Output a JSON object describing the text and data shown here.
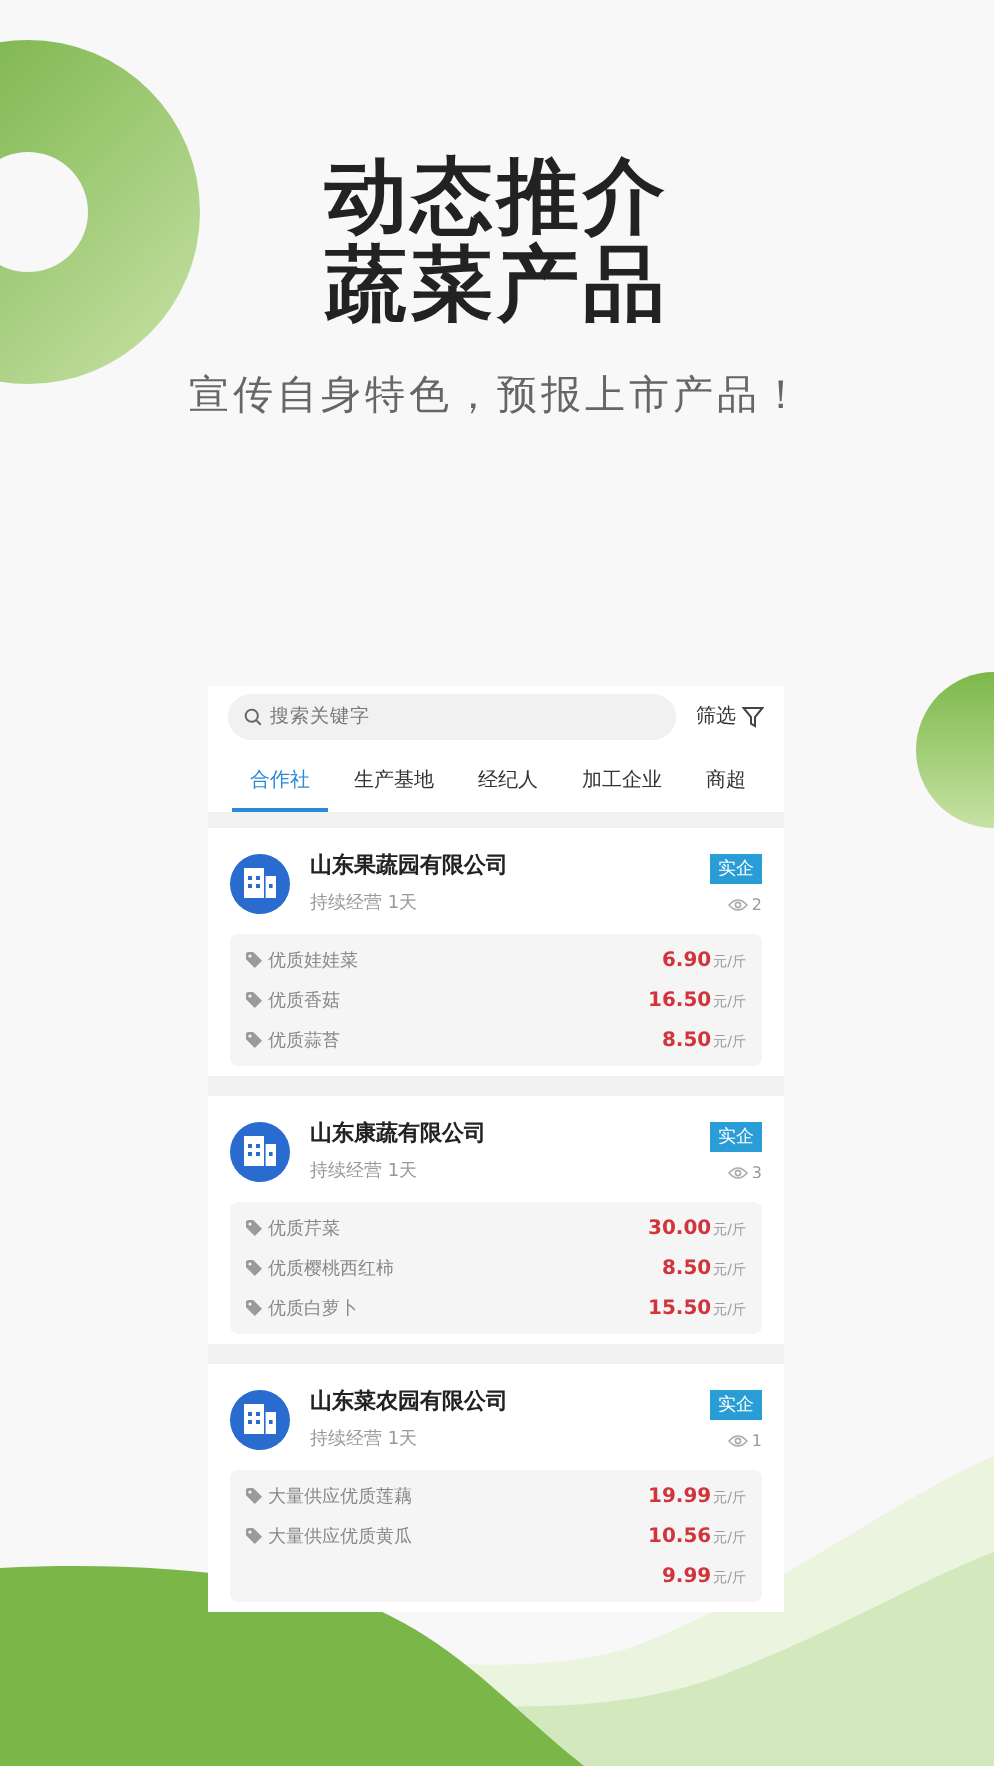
{
  "promo": {
    "headline": [
      "动态推介",
      "蔬菜产品"
    ],
    "tagline": "宣传自身特色，预报上市产品！"
  },
  "search": {
    "placeholder": "搜索关键字",
    "filter_label": "筛选"
  },
  "tabs": [
    {
      "label": "合作社",
      "selected": true
    },
    {
      "label": "生产基地",
      "selected": false
    },
    {
      "label": "经纪人",
      "selected": false
    },
    {
      "label": "加工企业",
      "selected": false
    },
    {
      "label": "商超",
      "selected": false
    }
  ],
  "companies": [
    {
      "name": "山东果蔬园有限公司",
      "badge": "实企",
      "subtitle": "持续经营 1天",
      "views": "2",
      "products": [
        {
          "name": "优质娃娃菜",
          "price": "6.90",
          "unit": "元/斤"
        },
        {
          "name": "优质香菇",
          "price": "16.50",
          "unit": "元/斤"
        },
        {
          "name": "优质蒜苔",
          "price": "8.50",
          "unit": "元/斤"
        }
      ]
    },
    {
      "name": "山东康蔬有限公司",
      "badge": "实企",
      "subtitle": "持续经营 1天",
      "views": "3",
      "products": [
        {
          "name": "优质芹菜",
          "price": "30.00",
          "unit": "元/斤"
        },
        {
          "name": "优质樱桃西红柿",
          "price": "8.50",
          "unit": "元/斤"
        },
        {
          "name": "优质白萝卜",
          "price": "15.50",
          "unit": "元/斤"
        }
      ]
    },
    {
      "name": "山东菜农园有限公司",
      "badge": "实企",
      "subtitle": "持续经营 1天",
      "views": "1",
      "products": [
        {
          "name": "大量供应优质莲藕",
          "price": "19.99",
          "unit": "元/斤"
        },
        {
          "name": "大量供应优质黄瓜",
          "price": "10.56",
          "unit": "元/斤"
        },
        {
          "price": "9.99",
          "unit": "元/斤"
        }
      ]
    }
  ]
}
